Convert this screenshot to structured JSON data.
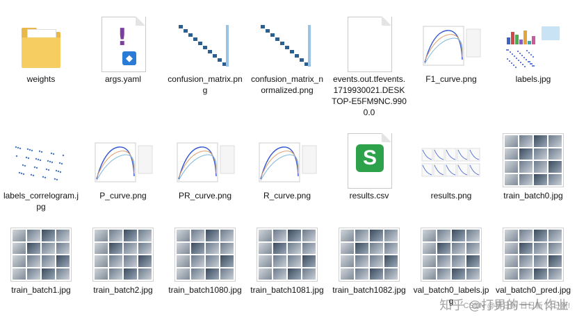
{
  "files": [
    {
      "name": "weights",
      "kind": "folder"
    },
    {
      "name": "args.yaml",
      "kind": "yaml"
    },
    {
      "name": "confusion_matrix.png",
      "kind": "matrix"
    },
    {
      "name": "confusion_matrix_normalized.png",
      "kind": "matrix"
    },
    {
      "name": "events.out.tfevents.1719930021.DESKTOP-E5FM9NC.9900.0",
      "kind": "blank"
    },
    {
      "name": "F1_curve.png",
      "kind": "curve"
    },
    {
      "name": "labels.jpg",
      "kind": "labels"
    },
    {
      "name": "labels_correlogram.jpg",
      "kind": "correlogram"
    },
    {
      "name": "P_curve.png",
      "kind": "curve"
    },
    {
      "name": "PR_curve.png",
      "kind": "curve"
    },
    {
      "name": "R_curve.png",
      "kind": "curve"
    },
    {
      "name": "results.csv",
      "kind": "csv"
    },
    {
      "name": "results.png",
      "kind": "results"
    },
    {
      "name": "train_batch0.jpg",
      "kind": "mosaic"
    },
    {
      "name": "train_batch1.jpg",
      "kind": "mosaic"
    },
    {
      "name": "train_batch2.jpg",
      "kind": "mosaic"
    },
    {
      "name": "train_batch1080.jpg",
      "kind": "mosaic"
    },
    {
      "name": "train_batch1081.jpg",
      "kind": "mosaic"
    },
    {
      "name": "train_batch1082.jpg",
      "kind": "mosaic"
    },
    {
      "name": "val_batch0_labels.jpg",
      "kind": "mosaic"
    },
    {
      "name": "val_batch0_pred.jpg",
      "kind": "mosaic"
    }
  ],
  "watermark": {
    "text": "知乎 @打男的一人作业",
    "csdn": "CSDN @日日新 日日新 又日新!"
  },
  "colors": {
    "folder": "#f6cd60",
    "yaml": "#7a3fa0",
    "csv": "#2ea24b",
    "curve_blue": "#2f55d4"
  }
}
